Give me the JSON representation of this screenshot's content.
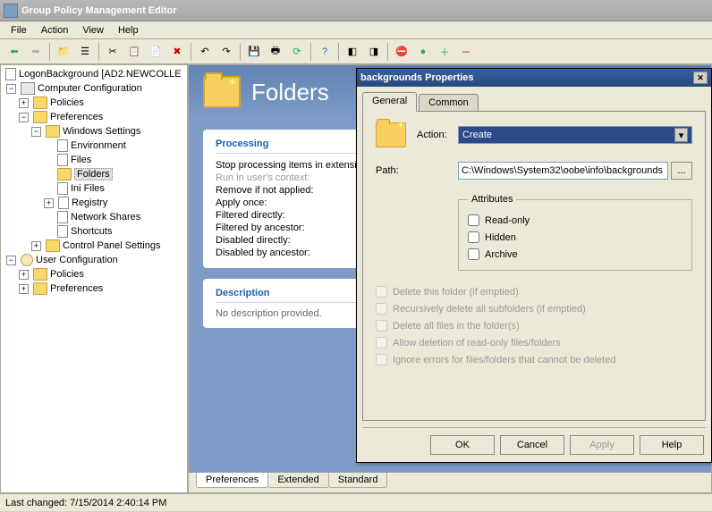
{
  "window": {
    "title": "Group Policy Management Editor"
  },
  "menu": {
    "file": "File",
    "action": "Action",
    "view": "View",
    "help": "Help"
  },
  "tree": {
    "root": "LogonBackground [AD2.NEWCOLLE",
    "comp_config": "Computer Configuration",
    "policies": "Policies",
    "preferences": "Preferences",
    "windows_settings": "Windows Settings",
    "environment": "Environment",
    "files": "Files",
    "folders": "Folders",
    "ini_files": "Ini Files",
    "registry": "Registry",
    "network_shares": "Network Shares",
    "shortcuts": "Shortcuts",
    "control_panel": "Control Panel Settings",
    "user_config": "User Configuration"
  },
  "header": {
    "title": "Folders"
  },
  "processing": {
    "title": "Processing",
    "rows": [
      {
        "label": "Stop processing items in extension on error:",
        "grey": false
      },
      {
        "label": "Run in user's context:",
        "grey": true
      },
      {
        "label": "Remove if not applied:",
        "grey": false
      },
      {
        "label": "Apply once:",
        "grey": false
      },
      {
        "label": "Filtered directly:",
        "grey": false
      },
      {
        "label": "Filtered by ancestor:",
        "grey": false
      },
      {
        "label": "Disabled directly:",
        "grey": false
      },
      {
        "label": "Disabled by ancestor:",
        "grey": false
      }
    ]
  },
  "description": {
    "title": "Description",
    "text": "No description provided."
  },
  "tabs": {
    "preferences": "Preferences",
    "extended": "Extended",
    "standard": "Standard"
  },
  "statusbar": {
    "text": "Last changed: 7/15/2014 2:40:14 PM"
  },
  "dialog": {
    "title": "backgrounds Properties",
    "tabs": {
      "general": "General",
      "common": "Common"
    },
    "action_label": "Action:",
    "action_value": "Create",
    "path_label": "Path:",
    "path_value": "C:\\Windows\\System32\\oobe\\info\\backgrounds",
    "attributes_legend": "Attributes",
    "attr_readonly": "Read-only",
    "attr_hidden": "Hidden",
    "attr_archive": "Archive",
    "opts": [
      "Delete this folder (if emptied)",
      "Recursively delete all subfolders (if emptied)",
      "Delete all files in the folder(s)",
      "Allow deletion of read-only files/folders",
      "Ignore errors for files/folders that cannot be deleted"
    ],
    "btn_ok": "OK",
    "btn_cancel": "Cancel",
    "btn_apply": "Apply",
    "btn_help": "Help"
  }
}
